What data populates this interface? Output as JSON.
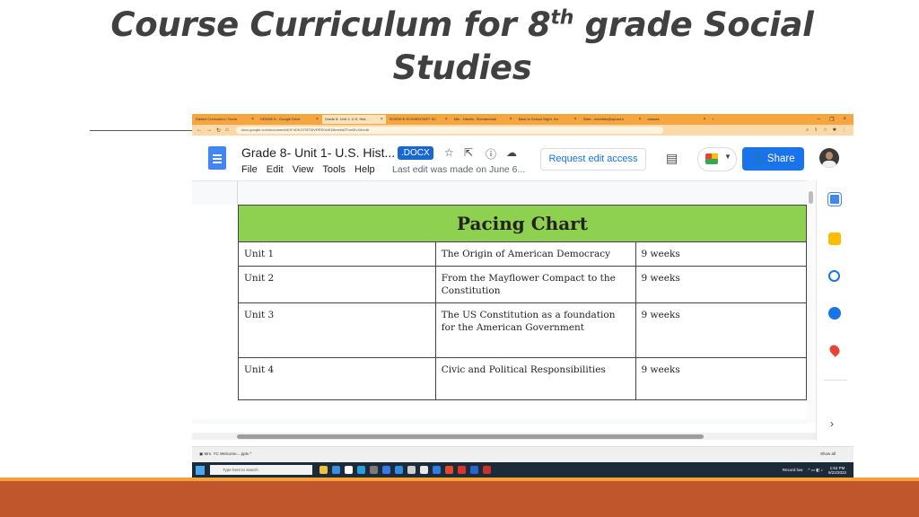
{
  "slide": {
    "title_before_sup": "Course Curriculum for 8",
    "title_sup": "th",
    "title_after_sup": " grade Social",
    "title_line2": "Studies"
  },
  "browser": {
    "tabs": [
      {
        "label": "District Curriculum / Socia",
        "active": false
      },
      {
        "label": "GRADE 8 - Google Drive",
        "active": false
      },
      {
        "label": "Grade 8- Unit 1- U.S. Hist...",
        "active": true
      },
      {
        "label": "SCIENCE ELEMENTARY SC",
        "active": false
      },
      {
        "label": "Mtn - Hamlin, Shenandoah",
        "active": false
      },
      {
        "label": "Back to School Night, Inc",
        "active": false
      },
      {
        "label": "Slate - sheetsts@spusd.k",
        "active": false
      },
      {
        "label": "classes",
        "active": false
      }
    ],
    "url": "docs.google.com/document/d/1FnDKGTiSTMVRRS0vW1BmebdZTnetEvXd/edit"
  },
  "doc": {
    "title": "Grade 8- Unit 1- U.S. Hist...",
    "badge": ".DOCX",
    "menu": [
      "File",
      "Edit",
      "View",
      "Tools",
      "Help"
    ],
    "last_edit": "Last edit was made on June 6...",
    "request_edit": "Request edit access",
    "share": "Share"
  },
  "pacing_chart": {
    "heading": "Pacing Chart",
    "rows": [
      {
        "unit": "Unit 1",
        "topic": "The Origin of American Democracy",
        "duration": "9 weeks"
      },
      {
        "unit": "Unit 2",
        "topic": "From the Mayflower Compact to the Constitution",
        "duration": "9 weeks"
      },
      {
        "unit": "Unit 3",
        "topic": "The US Constitution as a foundation for the American Government",
        "duration": "9 weeks"
      },
      {
        "unit": "Unit 4",
        "topic": "Civic and Political Responsibilities",
        "duration": "9 weeks"
      }
    ]
  },
  "downloads": {
    "item": "Mrs. YC Welcome....pptx",
    "show_all": "Show all"
  },
  "taskbar": {
    "search_placeholder": "Type here to search",
    "tray_label": "Record low",
    "time": "1:54 PM",
    "date": "9/22/2022"
  },
  "colors": {
    "title_text": "#404040",
    "pacing_header": "#8ed150",
    "band": "#c0562c",
    "stripe": "#f4a13a",
    "share_button": "#1a73e8"
  }
}
